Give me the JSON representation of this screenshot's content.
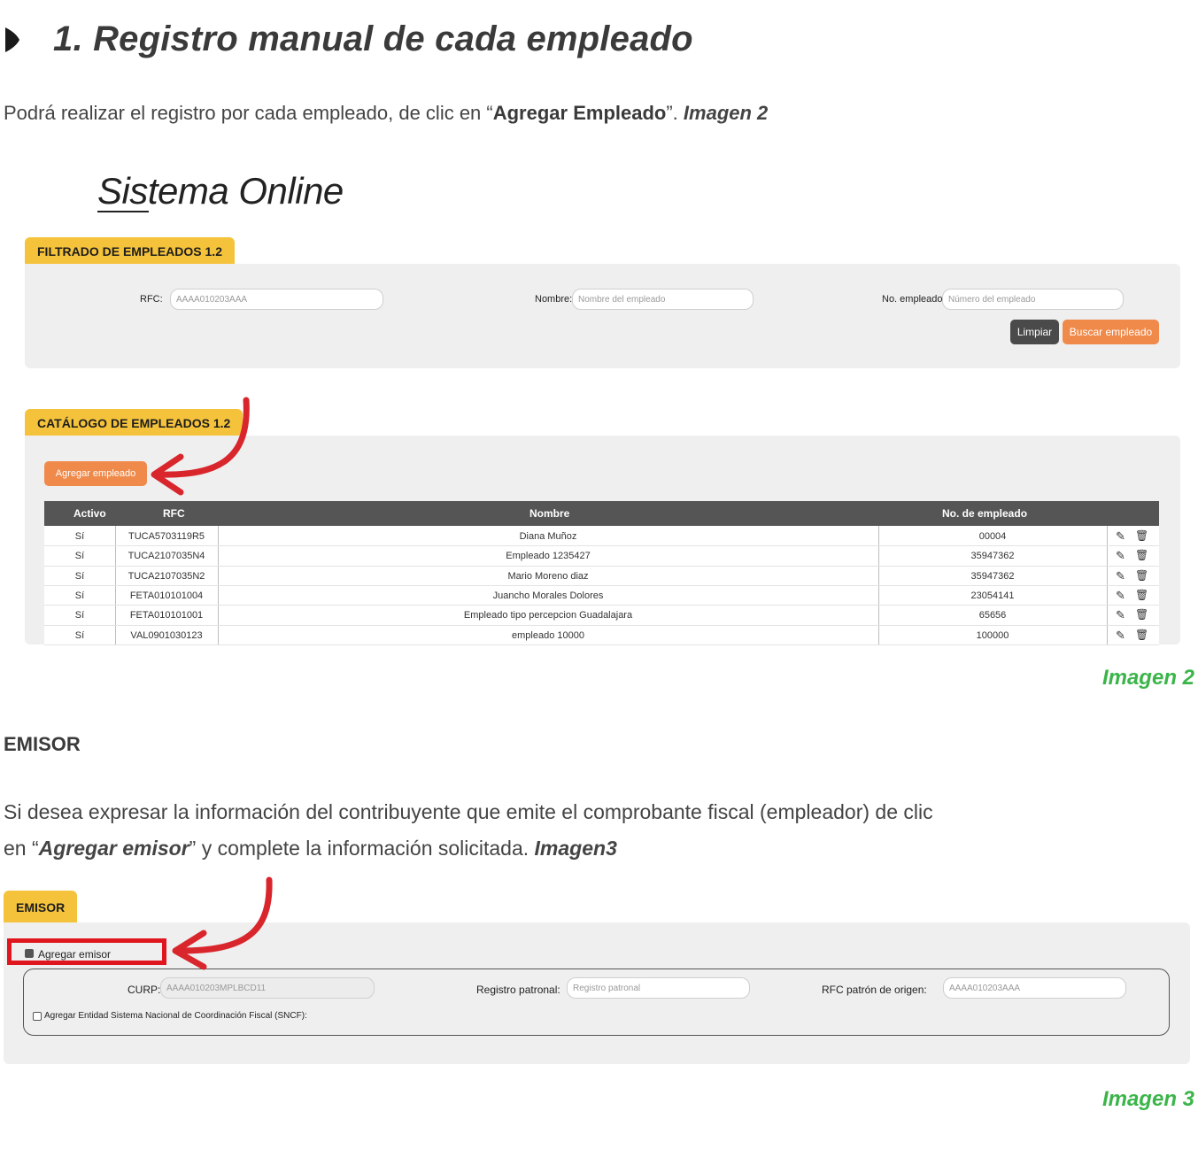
{
  "heading": {
    "title": "1. Registro manual de cada empleado"
  },
  "intro": {
    "text_before": "Podrá realizar el registro por cada empleado, de clic en “",
    "bold": "Agregar Empleado",
    "text_after": "”. ",
    "ref": "Imagen 2"
  },
  "image2": {
    "brand": "Sistema Online",
    "filter": {
      "tab": "FILTRADO DE EMPLEADOS 1.2",
      "rfc_label": "RFC:",
      "rfc_placeholder": "AAAA010203AAA",
      "nombre_label": "Nombre:",
      "nombre_placeholder": "Nombre del empleado",
      "noemp_label": "No. empleado:",
      "noemp_placeholder": "Número del empleado",
      "clear_label": "Limpiar",
      "search_label": "Buscar empleado"
    },
    "catalog": {
      "tab": "CATÁLOGO DE EMPLEADOS 1.2",
      "add_label": "Agregar empleado",
      "columns": [
        "Activo",
        "RFC",
        "Nombre",
        "No. de empleado"
      ],
      "rows": [
        [
          "Sí",
          "TUCA5703119R5",
          "Diana Muñoz",
          "00004"
        ],
        [
          "Sí",
          "TUCA2107035N4",
          "Empleado 1235427",
          "35947362"
        ],
        [
          "Sí",
          "TUCA2107035N2",
          "Mario Moreno diaz",
          "35947362"
        ],
        [
          "Sí",
          "FETA010101004",
          "Juancho Morales Dolores",
          "23054141"
        ],
        [
          "Sí",
          "FETA010101001",
          "Empleado tipo percepcion Guadalajara",
          "65656"
        ],
        [
          "Sí",
          "VAL0901030123",
          "empleado 10000",
          "100000"
        ]
      ]
    },
    "caption": "Imagen 2"
  },
  "emisor_section": {
    "heading": "EMISOR",
    "line1": "Si desea expresar la información del contribuyente que emite el comprobante fiscal (empleador) de clic",
    "line2_before": "en “",
    "line2_em": "Agregar emisor",
    "line2_after": "” y complete la información solicitada. ",
    "line2_ref": "Imagen3"
  },
  "image3": {
    "tab": "EMISOR",
    "checkbox_label": "Agregar emisor",
    "curp_label": "CURP:",
    "curp_placeholder": "AAAA010203MPLBCD11",
    "registro_label": "Registro patronal:",
    "registro_placeholder": "Registro patronal",
    "rfc_origen_label": "RFC patrón de origen:",
    "rfc_origen_placeholder": "AAAA010203AAA",
    "sncf_label": "Agregar Entidad Sistema Nacional de Coordinación Fiscal (SNCF):",
    "caption": "Imagen 3"
  },
  "colors": {
    "tab_yellow": "#f5c33b",
    "orange": "#f08a4b",
    "green_caption": "#3bb54a",
    "arrow_red": "#d9262c"
  }
}
